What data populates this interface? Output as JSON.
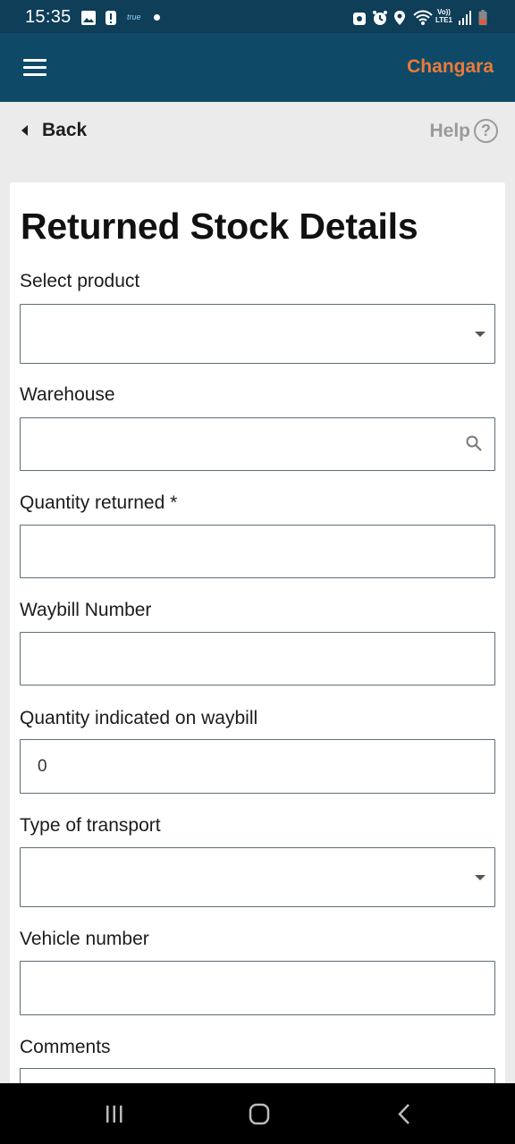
{
  "status_bar": {
    "time": "15:35",
    "carrier_badge": "true",
    "network_line1": "Vo))",
    "network_line2": "LTE1"
  },
  "app_bar": {
    "menu_icon": "hamburger-menu-icon",
    "brand": "Changara",
    "brand_color": "#ec7a3b",
    "background_color": "#0e4a67"
  },
  "subheader": {
    "back_label": "Back",
    "help_label": "Help",
    "help_icon": "?"
  },
  "form": {
    "title": "Returned Stock Details",
    "fields": {
      "product": {
        "label": "Select product",
        "value": ""
      },
      "warehouse": {
        "label": "Warehouse",
        "value": ""
      },
      "quantity_returned": {
        "label": "Quantity returned *",
        "value": ""
      },
      "waybill_number": {
        "label": "Waybill Number",
        "value": ""
      },
      "quantity_on_waybill": {
        "label": "Quantity indicated on waybill",
        "value": "0"
      },
      "transport_type": {
        "label": "Type of transport",
        "value": ""
      },
      "vehicle_number": {
        "label": "Vehicle number",
        "value": ""
      },
      "comments": {
        "label": "Comments",
        "value": ""
      }
    }
  },
  "nav_bar": {
    "recents_icon": "recent-apps-icon",
    "home_icon": "home-icon",
    "back_icon": "back-icon"
  }
}
